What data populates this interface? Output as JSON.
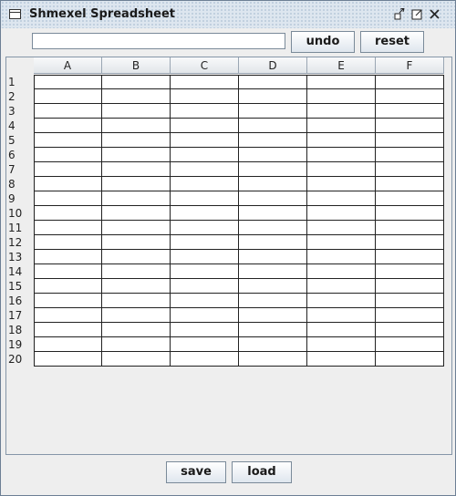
{
  "window": {
    "title": "Shmexel Spreadsheet"
  },
  "toolbar": {
    "formula_value": "",
    "undo_label": "undo",
    "reset_label": "reset"
  },
  "sheet": {
    "columns": [
      "A",
      "B",
      "C",
      "D",
      "E",
      "F"
    ],
    "rows": [
      "1",
      "2",
      "3",
      "4",
      "5",
      "6",
      "7",
      "8",
      "9",
      "10",
      "11",
      "12",
      "13",
      "14",
      "15",
      "16",
      "17",
      "18",
      "19",
      "20"
    ]
  },
  "scrollbar": {
    "left_arrow": "◀",
    "right_arrow": "▶"
  },
  "footer": {
    "save_label": "save",
    "load_label": "load"
  },
  "icons": {
    "minimize": "minimize-icon",
    "maximize": "maximize-icon",
    "close": "close-icon"
  },
  "colors": {
    "title_bar": "#dde6ef",
    "window_bg": "#eeeeee",
    "grid_line": "#222222"
  }
}
